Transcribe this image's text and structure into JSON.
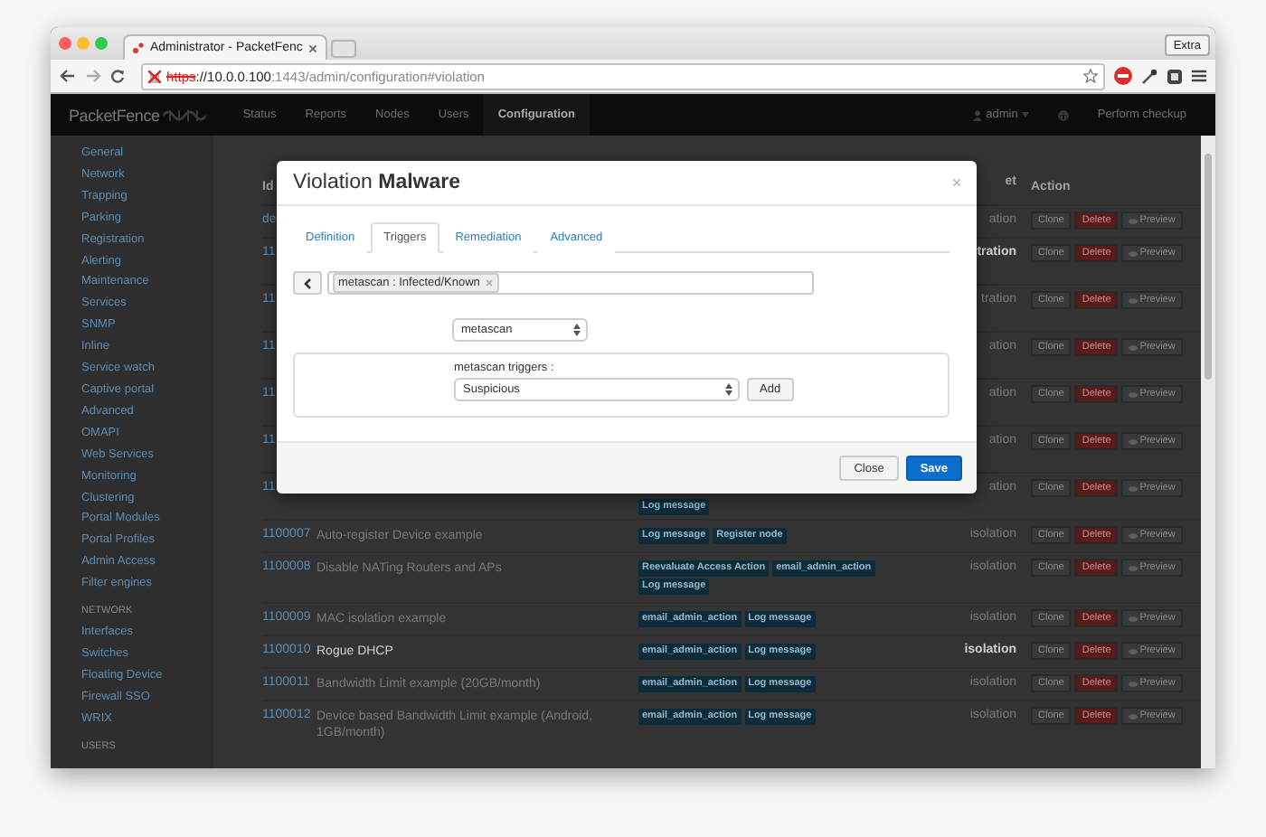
{
  "browser": {
    "tab_title": "Administrator - PacketFenc",
    "extra_button": "Extra",
    "url": {
      "scheme": "https",
      "host": "://10.0.0.100",
      "path": ":1443/admin/configuration#violation"
    }
  },
  "navbar": {
    "brand": "PacketFence",
    "items": [
      {
        "label": "Status",
        "selected": false
      },
      {
        "label": "Reports",
        "selected": false
      },
      {
        "label": "Nodes",
        "selected": false
      },
      {
        "label": "Users",
        "selected": false
      },
      {
        "label": "Configuration",
        "selected": true
      }
    ],
    "user": "admin",
    "checkup": "Perform checkup"
  },
  "sidebar": {
    "sections": [
      {
        "items": [
          "General",
          "Network",
          "Trapping",
          "Parking",
          "Registration",
          "Alerting",
          "Maintenance",
          "Services",
          "SNMP",
          "Inline",
          "Service watch",
          "Captive portal",
          "Advanced",
          "OMAPI",
          "Web Services",
          "Monitoring",
          "Clustering",
          "Portal Modules",
          "Portal Profiles",
          "Admin Access",
          "Filter engines"
        ]
      },
      {
        "header": "NETWORK",
        "items": [
          "Interfaces",
          "Switches",
          "Floating Device",
          "Firewall SSO",
          "WRIX"
        ]
      },
      {
        "header": "USERS"
      }
    ]
  },
  "table": {
    "columns": [
      "Id",
      "et",
      "Action"
    ],
    "rows": [
      {
        "id": "de",
        "target": "ation",
        "enabled": false,
        "buttons": {
          "clone": "Clone",
          "delete": "Delete",
          "preview": "Preview"
        }
      },
      {
        "id": "11",
        "target": "tration",
        "enabled": true,
        "buttons": {
          "clone": "Clone",
          "delete": "Delete",
          "preview": "Preview"
        }
      },
      {
        "id": "11",
        "target": "tration",
        "enabled": false,
        "buttons": {
          "clone": "Clone",
          "delete": "Delete",
          "preview": "Preview"
        }
      },
      {
        "id": "11",
        "target": "ation",
        "enabled": false,
        "buttons": {
          "clone": "Clone",
          "delete": "Delete",
          "preview": "Preview"
        }
      },
      {
        "id": "11",
        "target": "ation",
        "enabled": false,
        "buttons": {
          "clone": "Clone",
          "delete": "Delete",
          "preview": "Preview"
        }
      },
      {
        "id": "11",
        "target": "ation",
        "enabled": false,
        "buttons": {
          "clone": "Clone",
          "delete": "Delete",
          "preview": "Preview"
        }
      },
      {
        "id": "11",
        "actions": [
          "Log message"
        ],
        "target": "ation",
        "enabled": false,
        "buttons": {
          "clone": "Clone",
          "delete": "Delete",
          "preview": "Preview"
        }
      },
      {
        "id": "1100007",
        "description": "Auto-register Device example",
        "actions": [
          "Log message",
          "Register node"
        ],
        "target": "isolation",
        "enabled": false,
        "buttons": {
          "clone": "Clone",
          "delete": "Delete",
          "preview": "Preview"
        }
      },
      {
        "id": "1100008",
        "description": "Disable NATing Routers and APs",
        "actions": [
          "Reevaluate Access Action",
          "email_admin_action",
          "Log message"
        ],
        "target": "isolation",
        "enabled": false,
        "buttons": {
          "clone": "Clone",
          "delete": "Delete",
          "preview": "Preview"
        }
      },
      {
        "id": "1100009",
        "description": "MAC isolation example",
        "actions": [
          "email_admin_action",
          "Log message"
        ],
        "target": "isolation",
        "enabled": false,
        "buttons": {
          "clone": "Clone",
          "delete": "Delete",
          "preview": "Preview"
        }
      },
      {
        "id": "1100010",
        "description": "Rogue DHCP",
        "actions": [
          "email_admin_action",
          "Log message"
        ],
        "target": "isolation",
        "enabled": true,
        "buttons": {
          "clone": "Clone",
          "delete": "Delete",
          "preview": "Preview"
        }
      },
      {
        "id": "1100011",
        "description": "Bandwidth Limit example (20GB/month)",
        "actions": [
          "email_admin_action",
          "Log message"
        ],
        "target": "isolation",
        "enabled": false,
        "buttons": {
          "clone": "Clone",
          "delete": "Delete",
          "preview": "Preview"
        }
      },
      {
        "id": "1100012",
        "description": "Device based Bandwidth Limit example (Android, 1GB/month)",
        "actions": [
          "email_admin_action",
          "Log message"
        ],
        "target": "isolation",
        "enabled": false,
        "buttons": {
          "clone": "Clone",
          "delete": "Delete",
          "preview": "Preview"
        }
      }
    ]
  },
  "modal": {
    "title": "Violation **Malware**",
    "tabs": [
      {
        "label": "Definition",
        "selected": false
      },
      {
        "label": "Triggers",
        "selected": true
      },
      {
        "label": "Remediation",
        "selected": false
      },
      {
        "label": "Advanced",
        "selected": false
      }
    ],
    "trigger_tags": [
      "metascan : Infected/Known"
    ],
    "type_select": "metascan",
    "triggers_label": "metascan triggers :",
    "trigger_select": "Suspicious",
    "add_button": "Add",
    "close_button": "Close",
    "save_button": "Save"
  }
}
